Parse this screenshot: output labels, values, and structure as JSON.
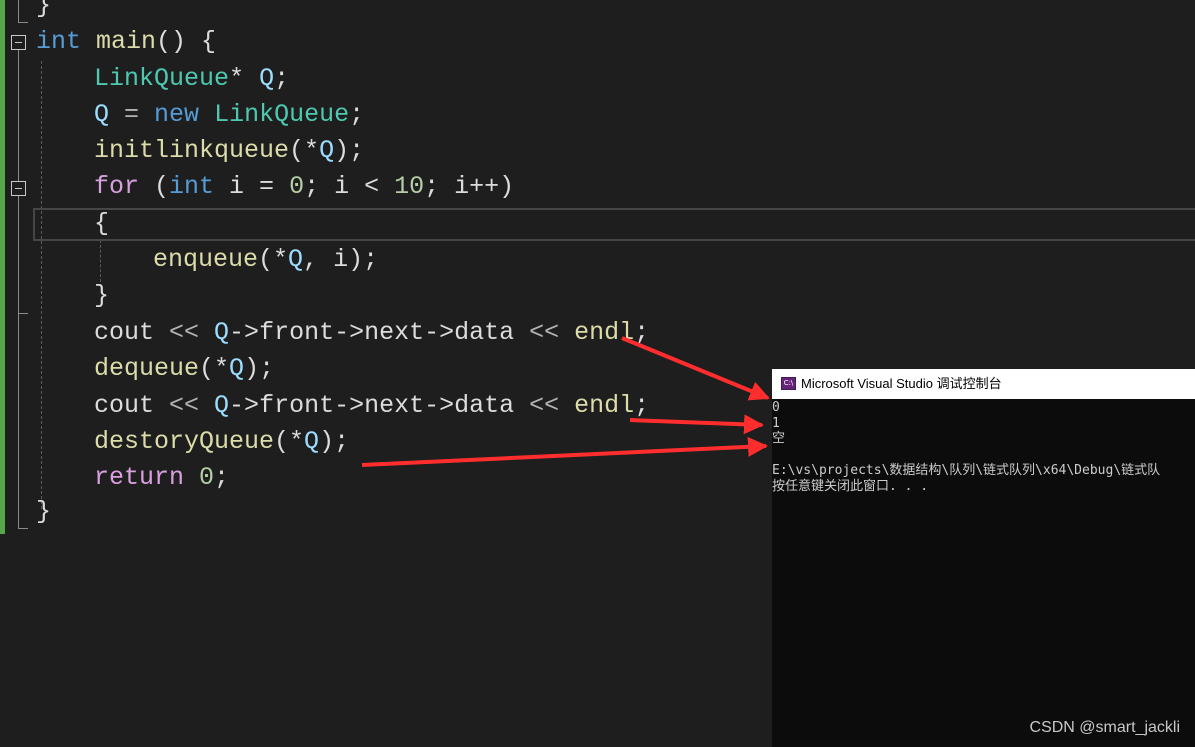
{
  "code": {
    "line0": "}",
    "line1": {
      "kw": "int",
      "name": "main",
      "rest": "() {"
    },
    "line2": {
      "type": "LinkQueue",
      "star": "*",
      "var": "Q",
      "end": ";"
    },
    "line3": {
      "var": "Q",
      "op": " = ",
      "kw": "new",
      "type": "LinkQueue",
      "end": ";"
    },
    "line4": {
      "fn": "initlinkqueue",
      "open": "(*",
      "var": "Q",
      "end": ");"
    },
    "line5": {
      "ctl": "for",
      "p1": " (",
      "kw": "int",
      "i1": " i = ",
      "num1": "0",
      "i2": "; i < ",
      "num2": "10",
      "i3": "; i++)"
    },
    "line6": "{",
    "line7": {
      "fn": "enqueue",
      "open": "(*",
      "var": "Q",
      "mid": ", ",
      "i": "i",
      "end": ");"
    },
    "line8": "}",
    "line9": {
      "var1": "cout",
      "op1": " << ",
      "var2": "Q",
      "arrow1": "->",
      "m1": "front",
      "arrow2": "->",
      "m2": "next",
      "arrow3": "->",
      "m3": "data",
      "op2": " << ",
      "var3": "endl",
      "end": ";"
    },
    "line10": {
      "fn": "dequeue",
      "open": "(*",
      "var": "Q",
      "end": ");"
    },
    "line11": {
      "var1": "cout",
      "op1": " << ",
      "var2": "Q",
      "arrow1": "->",
      "m1": "front",
      "arrow2": "->",
      "m2": "next",
      "arrow3": "->",
      "m3": "data",
      "op2": " << ",
      "var3": "endl",
      "end": ";"
    },
    "line12": {
      "fn": "destoryQueue",
      "open": "(*",
      "var": "Q",
      "end": ");"
    },
    "line13": {
      "ctl": "return",
      "sp": " ",
      "num": "0",
      "end": ";"
    },
    "line14": "}"
  },
  "console": {
    "title": "Microsoft Visual Studio 调试控制台",
    "icon_label": "C:\\",
    "output": [
      "0",
      "1",
      "空",
      "",
      "E:\\vs\\projects\\数据结构\\队列\\链式队列\\x64\\Debug\\链式队",
      "按任意键关闭此窗口. . ."
    ]
  },
  "watermark": "CSDN @smart_jackli",
  "colors": {
    "background": "#1e1e1e",
    "keyword": "#569cd6",
    "control": "#d8a0df",
    "type": "#4ec9b0",
    "function": "#dcdcaa",
    "variable": "#9cdcfe",
    "number": "#b5cea8",
    "arrow_annotation": "#ff2d2d",
    "change_bar": "#57a64a"
  }
}
